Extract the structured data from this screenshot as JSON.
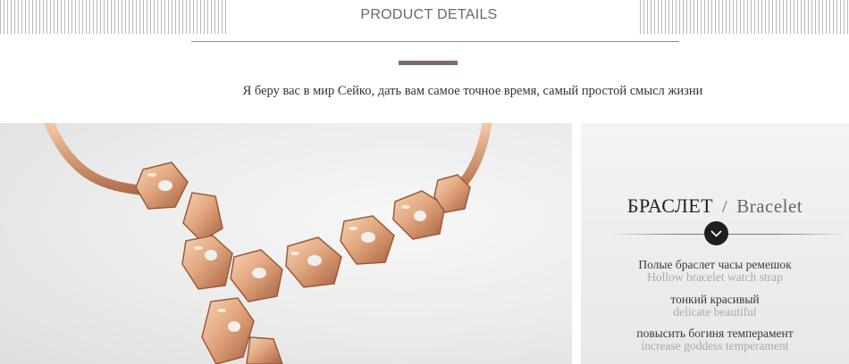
{
  "header": {
    "title": "PRODUCT DETAILS",
    "tagline": "Я беру вас в мир Сейко, дать вам самое точное время, самый простой смысл жизни"
  },
  "product_panel": {
    "title_ru": "БРАСЛЕТ",
    "separator": "/",
    "title_en": "Bracelet",
    "features": [
      {
        "ru": "Полые браслет часы ремешок",
        "en": "Hollow bracelet watch strap"
      },
      {
        "ru": "тонкий красивый",
        "en": "delicate beautiful"
      },
      {
        "ru": "повысить богиня темперамент",
        "en": "increase goddess temperament"
      }
    ]
  },
  "icons": {
    "divider_icon": "chevron-down-icon"
  },
  "colors": {
    "accent_bar": "#7c6d68",
    "gold": "#e2a77f"
  }
}
